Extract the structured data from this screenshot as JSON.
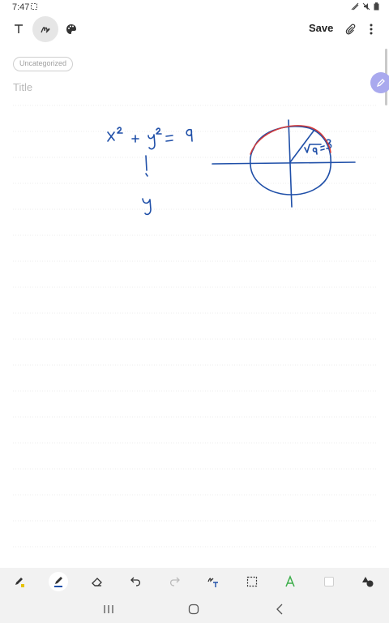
{
  "status": {
    "time": "7:47"
  },
  "toolbar": {
    "save_label": "Save"
  },
  "note": {
    "category": "Uncategorized",
    "title_placeholder": "Title"
  },
  "colors": {
    "ink_blue": "#1f4fa8",
    "ink_red": "#d23a3a",
    "accent": "#a9a9ee"
  }
}
